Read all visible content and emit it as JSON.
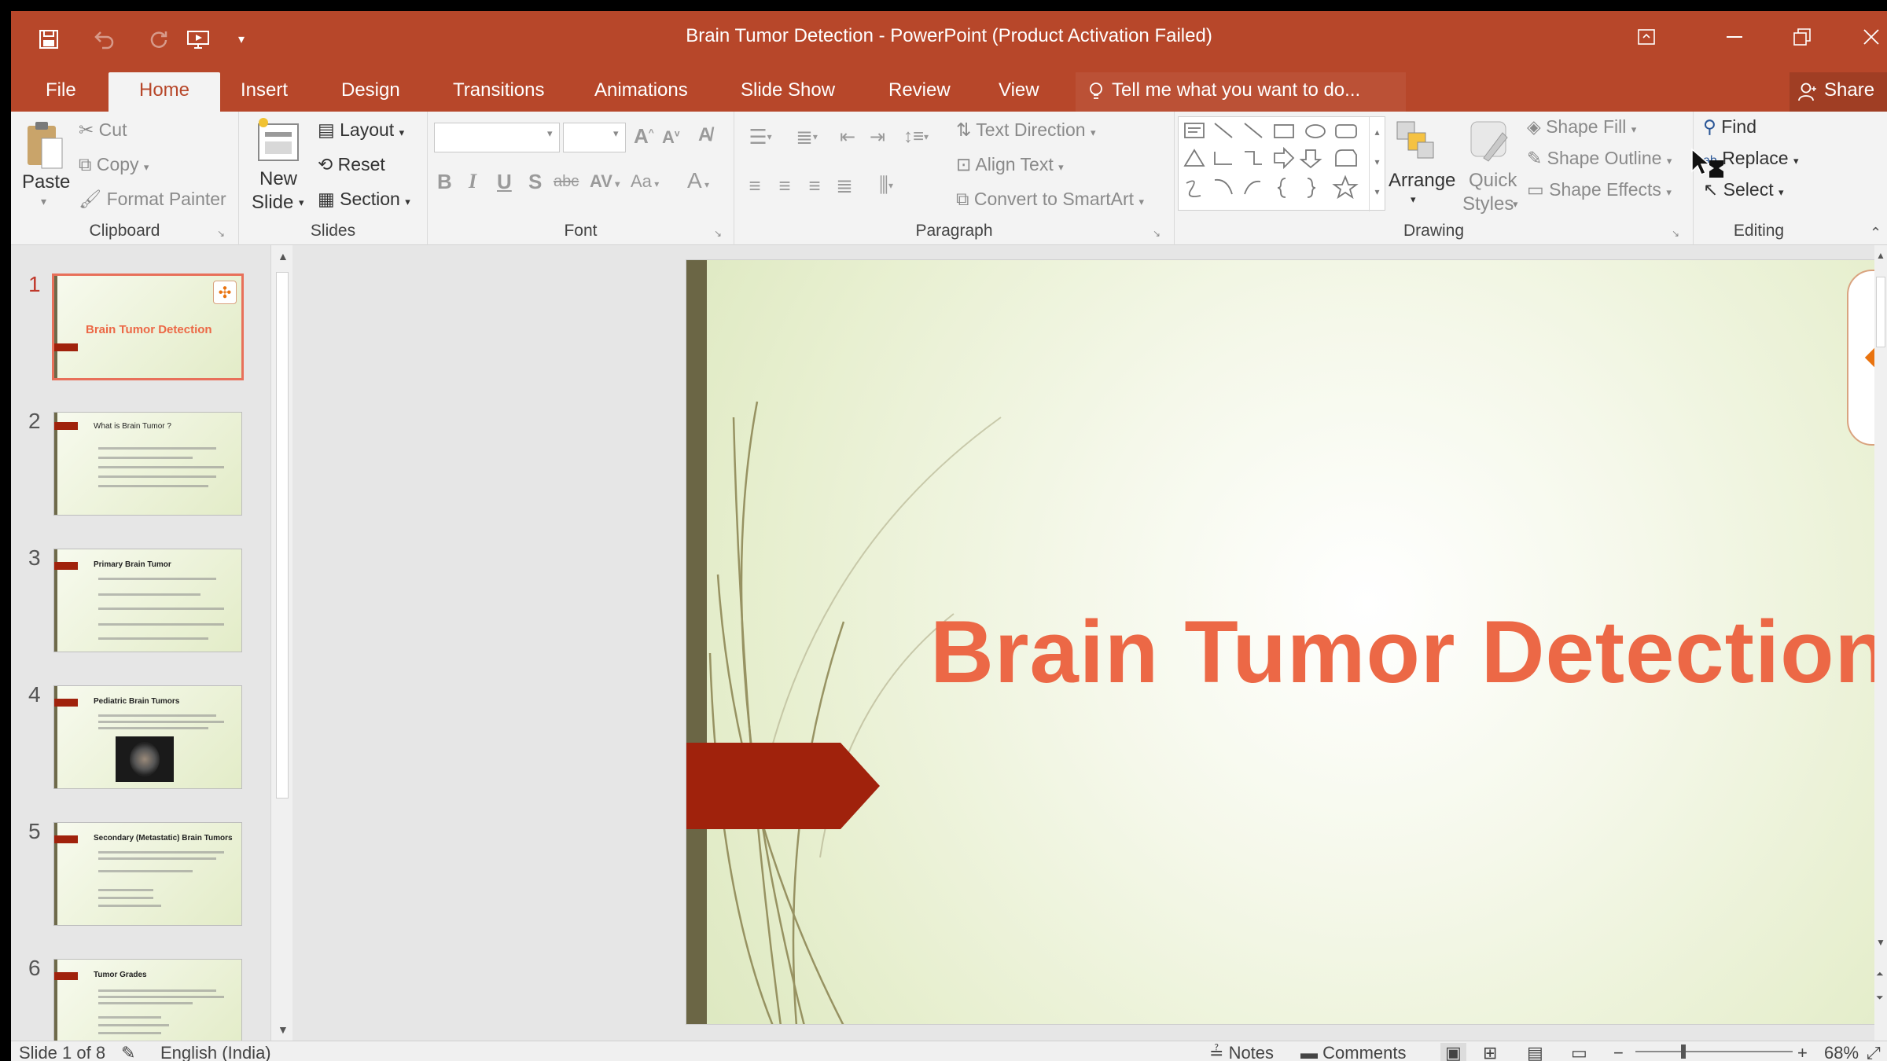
{
  "window": {
    "title": "Brain Tumor Detection - PowerPoint (Product Activation Failed)"
  },
  "tabs": [
    "File",
    "Home",
    "Insert",
    "Design",
    "Transitions",
    "Animations",
    "Slide Show",
    "Review",
    "View"
  ],
  "active_tab": "Home",
  "tell_me": "Tell me what you want to do...",
  "share_label": "Share",
  "ribbon": {
    "clipboard": {
      "label": "Clipboard",
      "paste": "Paste",
      "cut": "Cut",
      "copy": "Copy",
      "format_painter": "Format Painter"
    },
    "slides": {
      "label": "Slides",
      "new_slide_line1": "New",
      "new_slide_line2": "Slide",
      "layout": "Layout",
      "reset": "Reset",
      "section": "Section"
    },
    "font": {
      "label": "Font"
    },
    "paragraph": {
      "label": "Paragraph",
      "text_direction": "Text Direction",
      "align_text": "Align Text",
      "convert_smartart": "Convert to SmartArt"
    },
    "drawing": {
      "label": "Drawing",
      "arrange": "Arrange",
      "quick_styles_line1": "Quick",
      "quick_styles_line2": "Styles",
      "shape_fill": "Shape Fill",
      "shape_outline": "Shape Outline",
      "shape_effects": "Shape Effects"
    },
    "editing": {
      "label": "Editing",
      "find": "Find",
      "replace": "Replace",
      "select": "Select"
    }
  },
  "thumbnails": [
    {
      "num": "1",
      "title": "Brain Tumor Detection"
    },
    {
      "num": "2",
      "title": "What is Brain Tumor ?"
    },
    {
      "num": "3",
      "title": "Primary Brain Tumor"
    },
    {
      "num": "4",
      "title": "Pediatric Brain Tumors"
    },
    {
      "num": "5",
      "title": "Secondary (Metastatic) Brain Tumors"
    },
    {
      "num": "6",
      "title": "Tumor Grades"
    }
  ],
  "slide": {
    "title": "Brain Tumor Detection"
  },
  "status": {
    "slide_of": "Slide 1 of 8",
    "language": "English (India)",
    "notes": "Notes",
    "comments": "Comments",
    "zoom": "68%"
  },
  "colors": {
    "accent": "#b7472a",
    "slide_title": "#ec6846",
    "logo": "#e9730f",
    "flag": "#a0220c"
  }
}
